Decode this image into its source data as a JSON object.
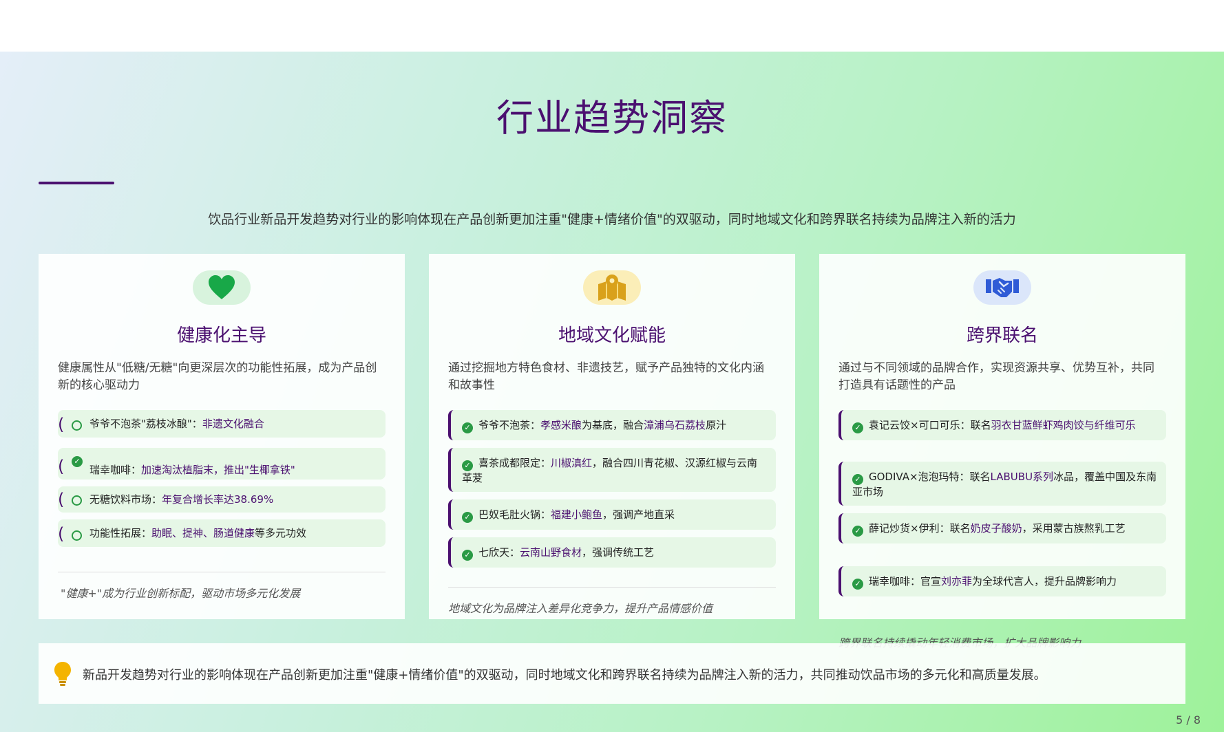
{
  "title": "行业趋势洞察",
  "subtitle": "饮品行业新品开发趋势对行业的影响体现在产品创新更加注重\"健康+情绪价值\"的双驱动，同时地域文化和跨界联名持续为品牌注入新的活力",
  "cards": [
    {
      "icon": "heart-icon",
      "title": "健康化主导",
      "desc": "健康属性从\"低糖/无糖\"向更深层次的功能性拓展，成为产品创新的核心驱动力",
      "items": [
        {
          "label": "爷爷不泡茶\"荔枝冰酿\"：",
          "highlight": "非遗文化融合",
          "rest": ""
        },
        {
          "label": "瑞幸咖啡：",
          "highlight": "加速淘汰植脂末，推出\"生椰拿铁\"",
          "rest": ""
        },
        {
          "label": "无糖饮料市场：",
          "highlight": "年复合增长率达38.69%",
          "rest": ""
        },
        {
          "label": "功能性拓展：",
          "highlight": "助眠、提神、肠道健康",
          "rest": "等多元功效"
        }
      ],
      "note": "\"健康+\"成为行业创新标配，驱动市场多元化发展"
    },
    {
      "icon": "map-pin-icon",
      "title": "地域文化赋能",
      "desc": "通过挖掘地方特色食材、非遗技艺，赋予产品独特的文化内涵和故事性",
      "items": [
        {
          "label": "爷爷不泡茶：",
          "highlight": "孝感米酿",
          "rest": "为基底，融合",
          "highlight2": "漳浦乌石荔枝",
          "rest2": "原汁"
        },
        {
          "label": "喜茶成都限定：",
          "highlight": "川椒滇红",
          "rest": "，融合四川青花椒、汉源红椒与云南革茇",
          "highlight2": "",
          "rest2": ""
        },
        {
          "label": "巴奴毛肚火锅：",
          "highlight": "福建小鲍鱼",
          "rest": "，强调产地直采",
          "highlight2": "",
          "rest2": ""
        },
        {
          "label": "七欣天：",
          "highlight": "云南山野食材",
          "rest": "，强调传统工艺",
          "highlight2": "",
          "rest2": ""
        }
      ],
      "note": "地域文化为品牌注入差异化竞争力，提升产品情感价值"
    },
    {
      "icon": "handshake-icon",
      "title": "跨界联名",
      "desc": "通过与不同领域的品牌合作，实现资源共享、优势互补，共同打造具有话题性的产品",
      "items": [
        {
          "label": "袁记云饺×可口可乐：联名",
          "highlight": "羽衣甘蓝鲜虾鸡肉饺与纤维可乐",
          "rest": ""
        },
        {
          "label": "GODIVA×泡泡玛特：联名",
          "highlight": "LABUBU系列",
          "rest": "冰品，覆盖中国及东南亚市场"
        },
        {
          "label": "薛记炒货×伊利：联名",
          "highlight": "奶皮子酸奶",
          "rest": "，采用蒙古族熬乳工艺"
        },
        {
          "label": "瑞幸咖啡：官宣",
          "highlight": "刘亦菲",
          "rest": "为全球代言人，提升品牌影响力"
        }
      ],
      "note": "跨界联名持续撬动年轻消费市场，扩大品牌影响力"
    }
  ],
  "summary": "新品开发趋势对行业的影响体现在产品创新更加注重\"健康+情绪价值\"的双驱动，同时地域文化和跨界联名持续为品牌注入新的活力，共同推动饮品市场的多元化和高质量发展。",
  "page_number": "5 / 8",
  "colors": {
    "accent": "#4b1070",
    "check": "#2a9a45",
    "item_bg": "#e6f7e6",
    "heart": "#18a848",
    "map": "#d9a11b",
    "handshake": "#2f5bd6"
  }
}
